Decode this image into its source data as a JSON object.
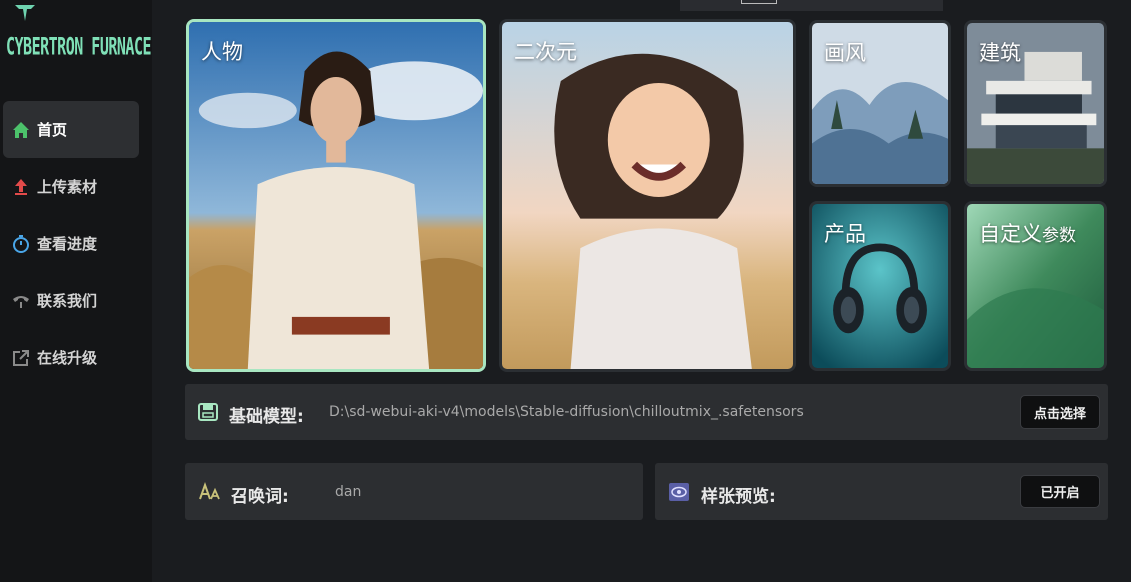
{
  "app": {
    "logo_text": "CYBERTRON FURNACE"
  },
  "sidebar": {
    "items": [
      {
        "label": "首页",
        "icon": "home-icon",
        "active": true
      },
      {
        "label": "上传素材",
        "icon": "upload-icon",
        "active": false
      },
      {
        "label": "查看进度",
        "icon": "timer-icon",
        "active": false
      },
      {
        "label": "联系我们",
        "icon": "phone-icon",
        "active": false
      },
      {
        "label": "在线升级",
        "icon": "external-link-icon",
        "active": false
      }
    ]
  },
  "categories": [
    {
      "label": "人物",
      "selected": true
    },
    {
      "label": "二次元",
      "selected": false
    },
    {
      "label": "画风",
      "selected": false
    },
    {
      "label": "建筑",
      "selected": false
    },
    {
      "label": "产品",
      "selected": false
    },
    {
      "label": "自定义",
      "label_small": "参数",
      "selected": false
    }
  ],
  "model": {
    "title": "基础模型:",
    "value": "D:\\sd-webui-aki-v4\\models\\Stable-diffusion\\chilloutmix_.safetensors",
    "button": "点击选择"
  },
  "prompt": {
    "title": "召唤词:",
    "value": "dan"
  },
  "preview": {
    "title": "样张预览:",
    "button": "已开启"
  },
  "colors": {
    "accent": "#a8e6c1",
    "logo": "#7fe0b7",
    "upload_icon": "#e24a4a"
  }
}
